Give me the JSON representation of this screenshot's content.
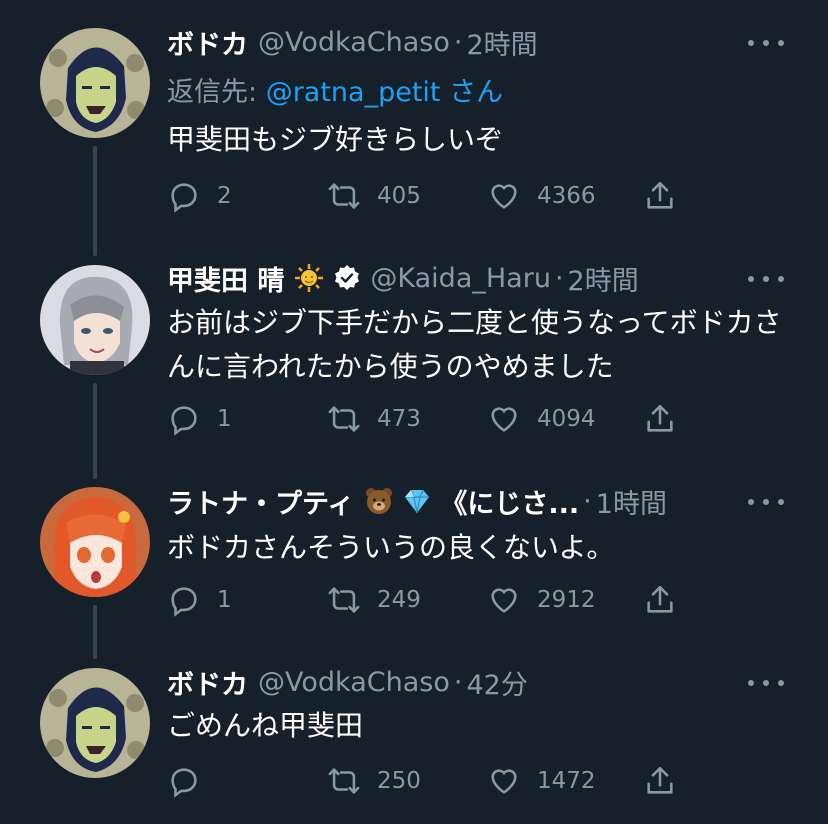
{
  "tweets": [
    {
      "name": "ボドカ",
      "handle": "@VodkaChaso",
      "dot": "·",
      "time": "2時間",
      "reply_prefix": "返信先: ",
      "reply_mention": "@ratna_petit",
      "reply_suffix": " さん",
      "text": "甲斐田もジブ好きらしいぞ",
      "replies": "2",
      "retweets": "405",
      "likes": "4366",
      "avatar": "vodka-avatar"
    },
    {
      "name": "甲斐田 晴",
      "handle": "@Kaida_Haru",
      "dot": "·",
      "time": "2時間",
      "text": "お前はジブ下手だから二度と使うなってボドカさんに言われたから使うのやめました",
      "replies": "1",
      "retweets": "473",
      "likes": "4094",
      "avatar": "kaida-avatar",
      "emojis": [
        "sun-emoji",
        "verified-badge"
      ]
    },
    {
      "name": "ラトナ・プティ",
      "name_suffix": "《にじさ...",
      "dot": "·",
      "time": "1時間",
      "text": "ボドカさんそういうの良くないよ。",
      "replies": "1",
      "retweets": "249",
      "likes": "2912",
      "avatar": "ratna-avatar",
      "emojis": [
        "bear-emoji",
        "gem-emoji"
      ]
    },
    {
      "name": "ボドカ",
      "handle": "@VodkaChaso",
      "dot": "·",
      "time": "42分",
      "text": "ごめんね甲斐田",
      "replies": "",
      "retweets": "250",
      "likes": "1472",
      "avatar": "vodka-avatar"
    }
  ],
  "colors": {
    "background": "#15202b",
    "secondary_text": "#8899a6",
    "link": "#1da1f2",
    "thread_line": "#38444d"
  },
  "icons": [
    "reply-icon",
    "retweet-icon",
    "like-icon",
    "share-icon",
    "more-icon"
  ]
}
